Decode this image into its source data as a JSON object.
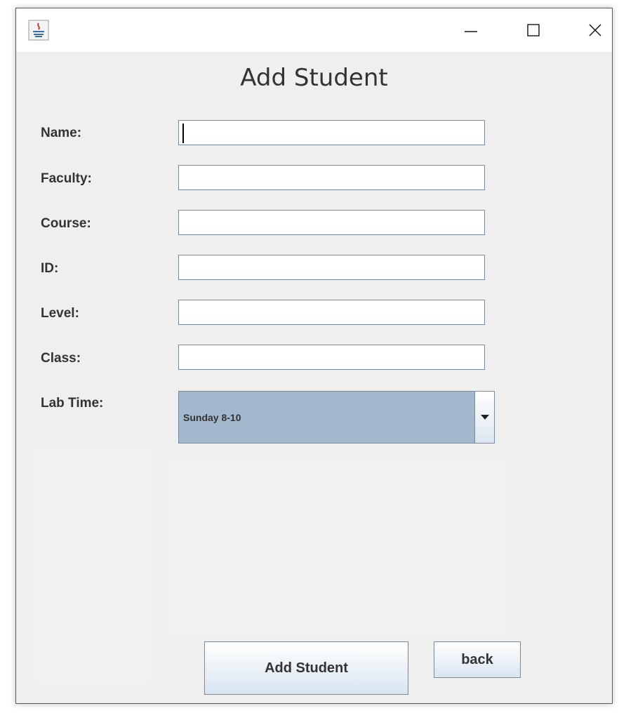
{
  "window": {
    "controls": {
      "minimize": "minimize-icon",
      "maximize": "maximize-icon",
      "close": "close-icon"
    }
  },
  "form": {
    "title": "Add Student",
    "fields": [
      {
        "label": "Name:",
        "value": ""
      },
      {
        "label": "Faculty:",
        "value": ""
      },
      {
        "label": "Course:",
        "value": ""
      },
      {
        "label": "ID:",
        "value": ""
      },
      {
        "label": "Level:",
        "value": ""
      },
      {
        "label": "Class:",
        "value": ""
      }
    ],
    "lab_time": {
      "label": "Lab Time:",
      "selected": "Sunday 8-10"
    },
    "add_button": "Add Student",
    "back_button": "back"
  },
  "colors": {
    "window_bg": "#efefef",
    "combo_bg": "#a3b8cc",
    "border": "#7a8a99"
  }
}
